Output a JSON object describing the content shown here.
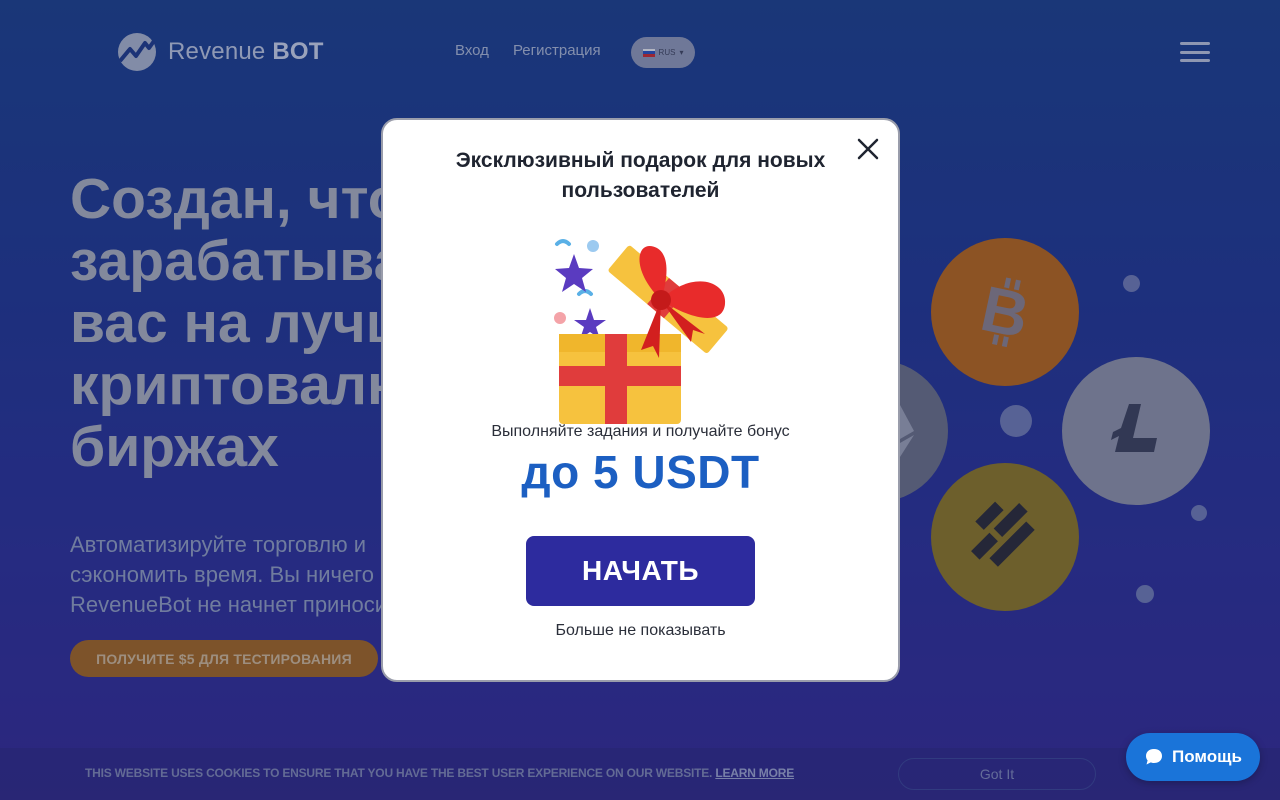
{
  "header": {
    "logo_light": "Revenue",
    "logo_bold": "BOT",
    "nav": {
      "login": "Вход",
      "register": "Регистрация"
    },
    "lang": "RUS"
  },
  "hero": {
    "title_lines": [
      "Создан, чтобы",
      "зарабатывать для",
      "вас на лучших",
      "криптовалютных",
      "биржах"
    ],
    "subtitle_lines": [
      "Автоматизируйте торговлю и",
      "сэкономить время. Вы ничего не",
      "RevenueBot не начнет приносить"
    ],
    "cta": "ПОЛУЧИТЕ $5 ДЛЯ ТЕСТИРОВАНИЯ"
  },
  "coins": [
    "bitcoin-icon",
    "ethereum-icon",
    "litecoin-icon",
    "binance-usd-icon"
  ],
  "cookie": {
    "text": "THIS WEBSITE USES COOKIES TO ENSURE THAT YOU HAVE THE BEST USER EXPERIENCE ON OUR WEBSITE.",
    "link": "LEARN MORE",
    "button": "Got It"
  },
  "help": {
    "label": "Помощь"
  },
  "modal": {
    "title": "Эксклюзивный подарок для новых пользователей",
    "description": "Выполняйте задания и получайте бонус",
    "amount": "до 5 USDT",
    "start_button": "НАЧАТЬ",
    "dismiss": "Больше не показывать"
  },
  "colors": {
    "accent_blue": "#1c5fc2",
    "button_indigo": "#2d2b9e",
    "help_blue": "#1a74d9",
    "cta_orange": "#e08a1e"
  }
}
